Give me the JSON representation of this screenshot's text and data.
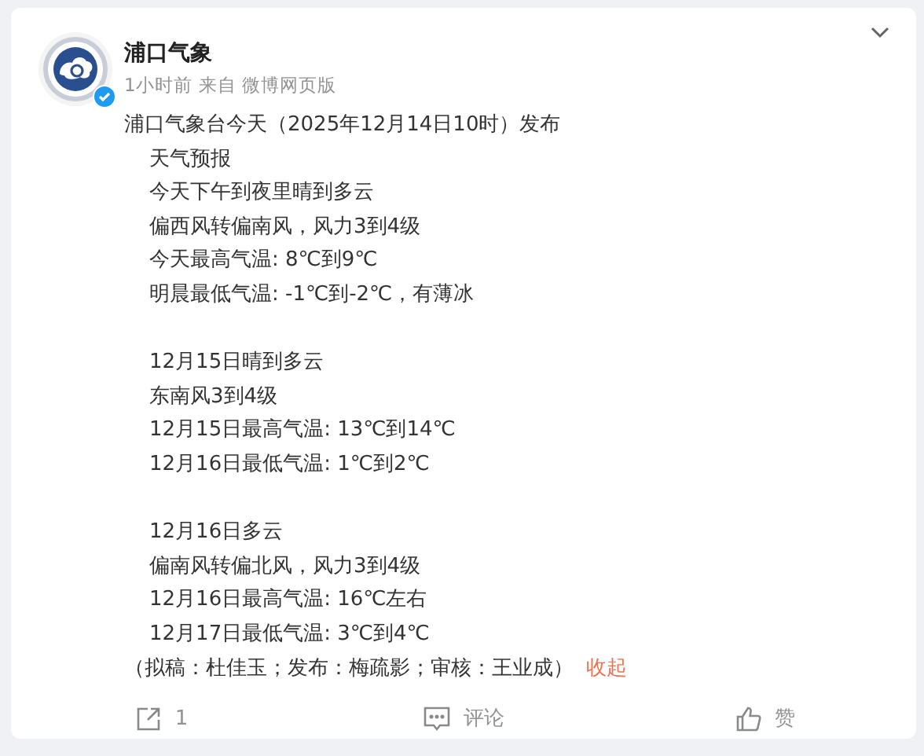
{
  "post": {
    "author": "浦口气象",
    "verified": true,
    "time": "1小时前",
    "source": "来自 微博网页版",
    "lead": "浦口气象台今天（2025年12月14日10时）发布",
    "sections": [
      [
        "天气预报",
        "今天下午到夜里晴到多云",
        "偏西风转偏南风，风力3到4级",
        "今天最高气温: 8℃到9℃",
        "明晨最低气温: -1℃到-2℃，有薄冰"
      ],
      [
        "12月15日晴到多云",
        "东南风3到4级",
        "12月15日最高气温: 13℃到14℃",
        "12月16日最低气温: 1℃到2℃"
      ],
      [
        "12月16日多云",
        "偏南风转偏北风，风力3到4级",
        "12月16日最高气温: 16℃左右",
        "12月17日最低气温: 3℃到4℃"
      ]
    ],
    "credit": "（拟稿：杜佳玉；发布：梅疏影；审核：王业成）",
    "collapse": "收起"
  },
  "actions": [
    {
      "kind": "repost",
      "label": "1"
    },
    {
      "kind": "comment",
      "label": "评论"
    },
    {
      "kind": "like",
      "label": "赞"
    }
  ]
}
